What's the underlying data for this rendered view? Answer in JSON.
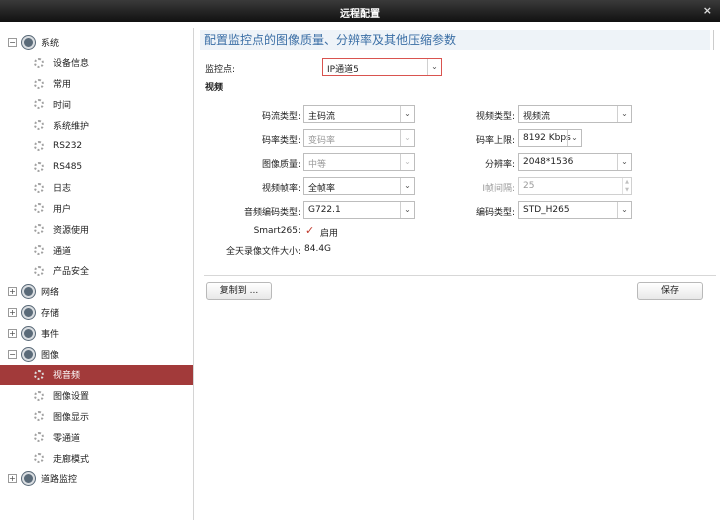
{
  "window": {
    "title": "远程配置",
    "close_glyph": "×"
  },
  "sidebar": {
    "items": [
      {
        "label": "系统",
        "level": 0,
        "toggle": "−"
      },
      {
        "label": "设备信息",
        "level": 1
      },
      {
        "label": "常用",
        "level": 1
      },
      {
        "label": "时间",
        "level": 1
      },
      {
        "label": "系统维护",
        "level": 1
      },
      {
        "label": "RS232",
        "level": 1
      },
      {
        "label": "RS485",
        "level": 1
      },
      {
        "label": "日志",
        "level": 1
      },
      {
        "label": "用户",
        "level": 1
      },
      {
        "label": "资源使用",
        "level": 1
      },
      {
        "label": "通道",
        "level": 1
      },
      {
        "label": "产品安全",
        "level": 1
      },
      {
        "label": "网络",
        "level": 0,
        "toggle": "+"
      },
      {
        "label": "存储",
        "level": 0,
        "toggle": "+"
      },
      {
        "label": "事件",
        "level": 0,
        "toggle": "+"
      },
      {
        "label": "图像",
        "level": 0,
        "toggle": "−"
      },
      {
        "label": "视音频",
        "level": 1,
        "selected": true
      },
      {
        "label": "图像设置",
        "level": 1
      },
      {
        "label": "图像显示",
        "level": 1
      },
      {
        "label": "零通道",
        "level": 1
      },
      {
        "label": "走廊模式",
        "level": 1
      },
      {
        "label": "道路监控",
        "level": 0,
        "toggle": "+"
      }
    ],
    "icons": {
      "group": "settings-gear-icon",
      "item": "gear-icon"
    }
  },
  "main": {
    "heading": "配置监控点的图像质量、分辨率及其他压缩参数",
    "camera": {
      "label": "监控点:",
      "value": "IP通道5"
    },
    "section_title": "视频",
    "fields": {
      "stream_type": {
        "label": "码流类型:",
        "value": "主码流"
      },
      "video_type": {
        "label": "视频类型:",
        "value": "视频流"
      },
      "bitrate_type": {
        "label": "码率类型:",
        "value": "变码率"
      },
      "bitrate_limit": {
        "label": "码率上限:",
        "value": "8192 Kbps"
      },
      "image_quality": {
        "label": "图像质量:",
        "value": "中等"
      },
      "resolution": {
        "label": "分辨率:",
        "value": "2048*1536"
      },
      "frame_rate": {
        "label": "视频帧率:",
        "value": "全帧率"
      },
      "i_frame_interval": {
        "label": "I帧间隔:",
        "value": "25"
      },
      "audio_encoding": {
        "label": "音频编码类型:",
        "value": "G722.1"
      },
      "encoding_type": {
        "label": "编码类型:",
        "value": "STD_H265"
      },
      "smart265": {
        "label": "Smart265:",
        "option": "启用",
        "checked": true
      },
      "daily_size": {
        "label": "全天录像文件大小:",
        "value": "84.4G"
      }
    },
    "copy_button": "复制到 ...",
    "save_button": "保存",
    "colors": {
      "selected_bg": "#a23a3a",
      "heading_text": "#3a6ea5",
      "check": "#c0392b"
    }
  }
}
